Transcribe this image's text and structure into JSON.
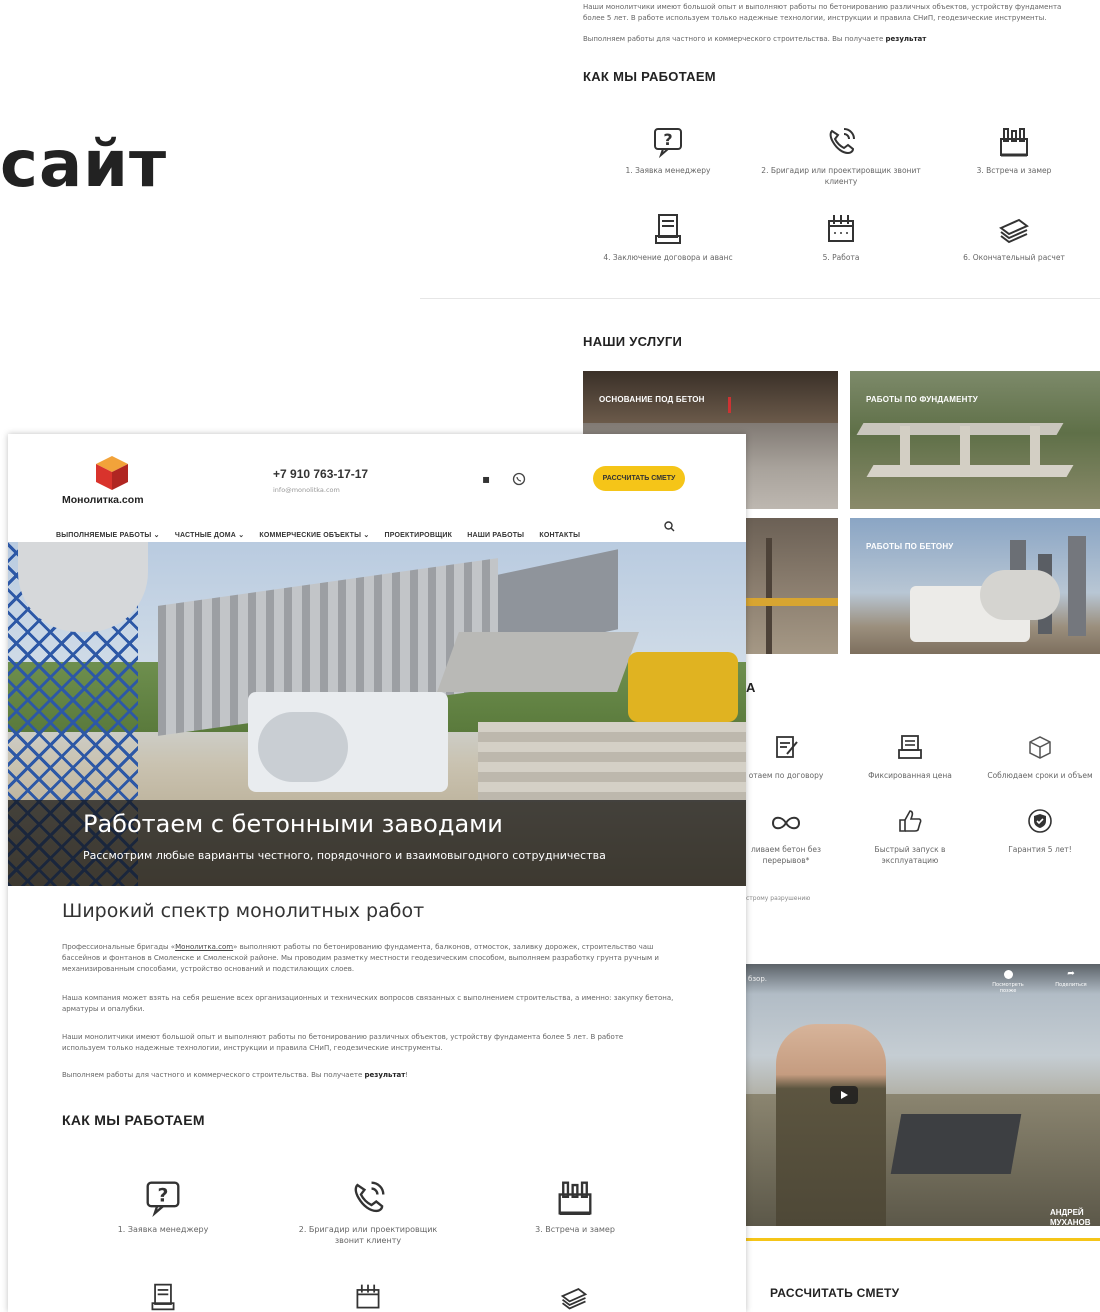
{
  "page_heading": "сайт",
  "back_page": {
    "text_line1": "Наши монолитчики имеют большой опыт и выполняют работы по бетонированию различных объектов, устройству фундамента",
    "text_line2": "более 5 лет. В работе используем только надежные технологии, инструкции и правила СНиП, геодезические инструменты.",
    "text_line3": "Выполняем работы для частного и коммерческого строительства. Вы получаете",
    "text_line3_bold": "результат",
    "how_title": "КАК МЫ РАБОТАЕМ",
    "steps": [
      {
        "label": "1. Заявка менеджеру",
        "icon": "question-icon"
      },
      {
        "label": "2. Бригадир или проектировщик звонит клиенту",
        "icon": "phone-icon"
      },
      {
        "label": "3. Встреча и замер",
        "icon": "factory-icon"
      },
      {
        "label": "4. Заключение договора и аванс",
        "icon": "document-icon"
      },
      {
        "label": "5. Работа",
        "icon": "blueprint-icon"
      },
      {
        "label": "6. Окончательный расчет",
        "icon": "money-icon"
      }
    ],
    "services_title": "НАШИ УСЛУГИ",
    "services": [
      {
        "label": "ОСНОВАНИЕ ПОД БЕТОН"
      },
      {
        "label": "РАБОТЫ ПО ФУНДАМЕНТУ"
      },
      {
        "label": ""
      },
      {
        "label": "РАБОТЫ ПО БЕТОНУ"
      }
    ],
    "adv_title_fragment": "А",
    "advantages": [
      {
        "label": "отаем по договору",
        "icon": "contract-icon"
      },
      {
        "label": "Фиксированная цена",
        "icon": "price-icon"
      },
      {
        "label": "Соблюдаем сроки и объем",
        "icon": "box-icon"
      },
      {
        "label": "ливаем бетон без перерывов*",
        "icon": "infinity-icon"
      },
      {
        "label": "Быстрый запуск в эксплуатацию",
        "icon": "thumbs-up-icon"
      },
      {
        "label": "Гарантия 5 лет!",
        "icon": "shield-icon"
      }
    ],
    "footnote": "строму разрушению",
    "video": {
      "title_fragment": "бзор.",
      "watch_later": "Посмотреть позже",
      "share": "Поделиться",
      "person_name": "АНДРЕЙ МУХАНОВ"
    },
    "estimate_title": "РАССЧИТАТЬ СМЕТУ"
  },
  "front_page": {
    "logo_text": "Монолитка.com",
    "phone": "+7 910 763-17-17",
    "email": "info@monolitka.com",
    "cta_label": "РАССЧИТАТЬ СМЕТУ",
    "nav": [
      {
        "label": "ВЫПОЛНЯЕМЫЕ РАБОТЫ",
        "dropdown": true
      },
      {
        "label": "ЧАСТНЫЕ ДОМА",
        "dropdown": true
      },
      {
        "label": "КОММЕРЧЕСКИЕ ОБЪЕКТЫ",
        "dropdown": true
      },
      {
        "label": "ПРОЕКТИРОВЩИК",
        "dropdown": false
      },
      {
        "label": "НАШИ РАБОТЫ",
        "dropdown": false
      },
      {
        "label": "КОНТАКТЫ",
        "dropdown": false
      }
    ],
    "hero_title": "Работаем с бетонными заводами",
    "hero_subtitle": "Рассмотрим любые варианты честного, порядочного и взаимовыгодного сотрудничества",
    "section_title": "Широкий спектр монолитных работ",
    "para1_pre": "Профессиональные бригады «",
    "para1_link": "Монолитка.com",
    "para1_post": "» выполняют работы по бетонированию фундамента, балконов, отмосток, заливку дорожек, строительство чаш бассейнов и фонтанов в Смоленске и Смоленской районе. Мы проводим разметку местности геодезическим способом, выполняем разработку грунта ручным и механизированным способами, устройство оснований и подстилающих слоев.",
    "para2": "Наша компания может взять на себя решение всех организационных и технических вопросов связанных с выполнением строительства, а именно: закупку бетона, арматуры и опалубки.",
    "para3": "Наши монолитчики имеют большой опыт и выполняют работы по бетонированию различных объектов, устройству фундамента более 5 лет. В работе используем только надежные технологии, инструкции и правила СНиП, геодезические инструменты.",
    "para4_pre": "Выполняем работы для частного и коммерческого строительства. Вы получаете ",
    "para4_bold": "результат",
    "para4_post": "!",
    "how_title": "КАК МЫ РАБОТАЕМ",
    "steps": [
      {
        "label": "1. Заявка менеджеру"
      },
      {
        "label": "2. Бригадир или проектировщик звонит клиенту"
      },
      {
        "label": "3. Встреча и замер"
      }
    ]
  }
}
